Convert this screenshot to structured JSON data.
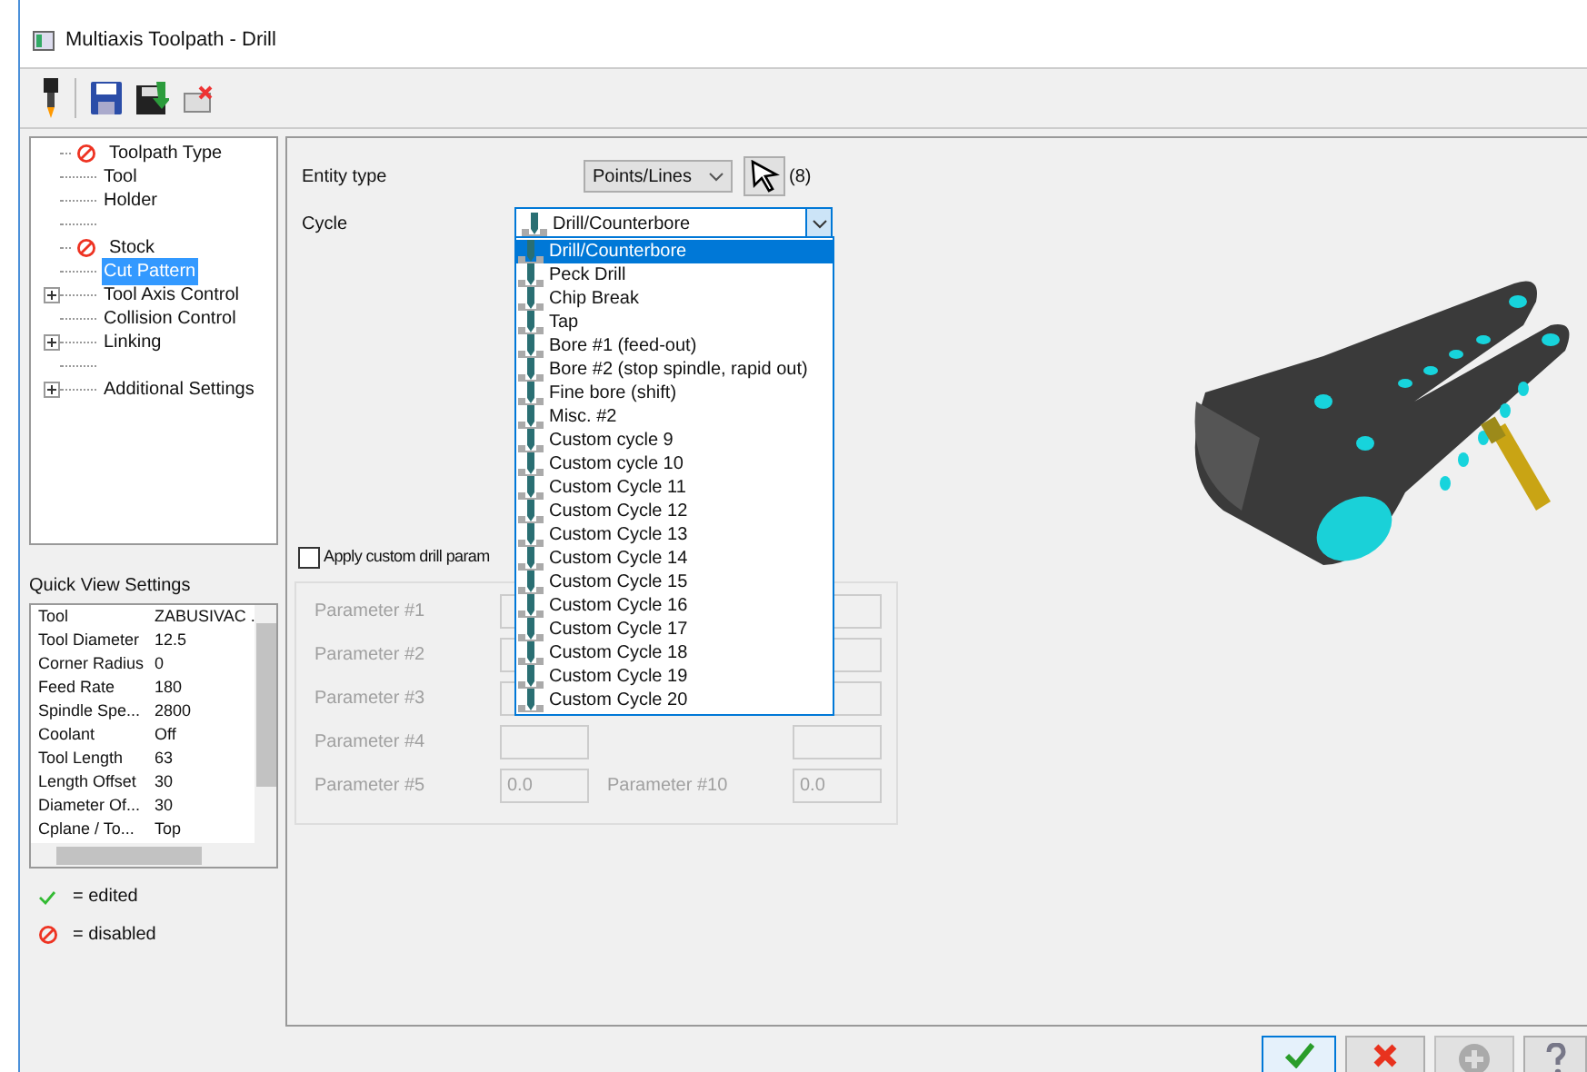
{
  "window": {
    "title": "Multiaxis Toolpath - Drill"
  },
  "tree": [
    {
      "kind": "item",
      "label": "Toolpath Type",
      "disabled": true,
      "expandable": false,
      "selected": false
    },
    {
      "kind": "item",
      "label": "Tool",
      "disabled": false,
      "expandable": false,
      "selected": false
    },
    {
      "kind": "item",
      "label": "Holder",
      "disabled": false,
      "expandable": false,
      "selected": false
    },
    {
      "kind": "spacer"
    },
    {
      "kind": "item",
      "label": "Stock",
      "disabled": true,
      "expandable": false,
      "selected": false
    },
    {
      "kind": "item",
      "label": "Cut Pattern",
      "disabled": false,
      "expandable": false,
      "selected": true
    },
    {
      "kind": "item",
      "label": "Tool Axis Control",
      "disabled": false,
      "expandable": true,
      "selected": false
    },
    {
      "kind": "item",
      "label": "Collision Control",
      "disabled": false,
      "expandable": false,
      "selected": false
    },
    {
      "kind": "item",
      "label": "Linking",
      "disabled": false,
      "expandable": true,
      "selected": false
    },
    {
      "kind": "spacer"
    },
    {
      "kind": "item",
      "label": "Additional Settings",
      "disabled": false,
      "expandable": true,
      "selected": false
    }
  ],
  "quick_view": {
    "title": "Quick View Settings",
    "rows": [
      {
        "name": "Tool",
        "value": "ZABUSIVAC ."
      },
      {
        "name": "Tool Diameter",
        "value": "12.5"
      },
      {
        "name": "Corner Radius",
        "value": "0"
      },
      {
        "name": "Feed Rate",
        "value": "180"
      },
      {
        "name": "Spindle Spe...",
        "value": "2800"
      },
      {
        "name": "Coolant",
        "value": "Off"
      },
      {
        "name": "Tool Length",
        "value": "63"
      },
      {
        "name": "Length Offset",
        "value": "30"
      },
      {
        "name": "Diameter Of...",
        "value": "30"
      },
      {
        "name": "Cplane / To...",
        "value": "Top"
      }
    ]
  },
  "legend": [
    {
      "kind": "edited",
      "text": "= edited"
    },
    {
      "kind": "disabled",
      "text": "= disabled"
    }
  ],
  "entity_type": {
    "label": "Entity type",
    "value": "Points/Lines",
    "count": "(8)"
  },
  "cycle": {
    "label": "Cycle",
    "value": "Drill/Counterbore",
    "expanded": true,
    "options": [
      {
        "label": "Drill/Counterbore",
        "selected": true
      },
      {
        "label": "Peck Drill",
        "selected": false
      },
      {
        "label": "Chip Break",
        "selected": false
      },
      {
        "label": "Tap",
        "selected": false
      },
      {
        "label": "Bore #1 (feed-out)",
        "selected": false
      },
      {
        "label": "Bore #2 (stop spindle, rapid out)",
        "selected": false
      },
      {
        "label": "Fine bore (shift)",
        "selected": false
      },
      {
        "label": "Misc. #2",
        "selected": false
      },
      {
        "label": "Custom cycle 9",
        "selected": false
      },
      {
        "label": "Custom cycle 10",
        "selected": false
      },
      {
        "label": "Custom Cycle 11",
        "selected": false
      },
      {
        "label": "Custom Cycle 12",
        "selected": false
      },
      {
        "label": "Custom Cycle 13",
        "selected": false
      },
      {
        "label": "Custom Cycle 14",
        "selected": false
      },
      {
        "label": "Custom Cycle 15",
        "selected": false
      },
      {
        "label": "Custom Cycle 16",
        "selected": false
      },
      {
        "label": "Custom Cycle 17",
        "selected": false
      },
      {
        "label": "Custom Cycle 18",
        "selected": false
      },
      {
        "label": "Custom Cycle 19",
        "selected": false
      },
      {
        "label": "Custom Cycle 20",
        "selected": false
      }
    ]
  },
  "custom_params": {
    "label": "Apply custom drill param",
    "checked": false,
    "rows": [
      {
        "left_label": "Parameter #1"
      },
      {
        "left_label": "Parameter #2"
      },
      {
        "left_label": "Parameter #3"
      },
      {
        "left_label": "Parameter #4"
      },
      {
        "left_label": "Parameter #5",
        "left_value": "0.0",
        "right_label": "Parameter #10",
        "right_value": "0.0"
      }
    ]
  },
  "buttons": [
    {
      "kind": "ok",
      "disabled": false
    },
    {
      "kind": "cancel",
      "disabled": false
    },
    {
      "kind": "add",
      "disabled": true
    },
    {
      "kind": "help",
      "disabled": false
    }
  ]
}
